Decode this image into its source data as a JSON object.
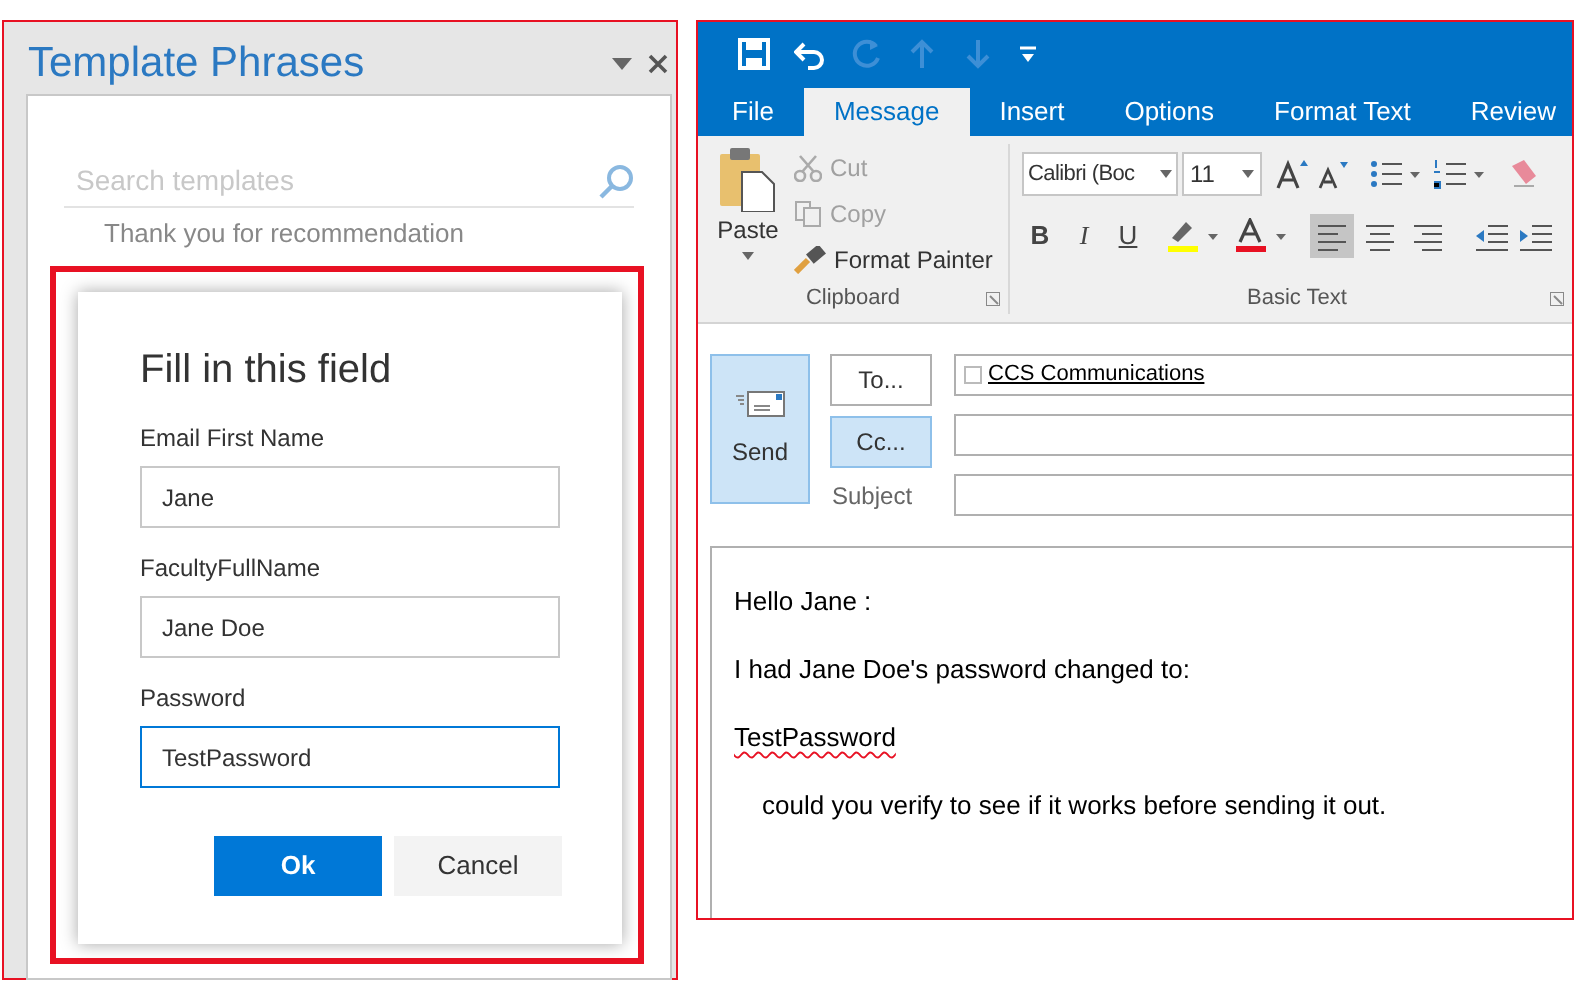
{
  "template_pane": {
    "title": "Template Phrases",
    "search": {
      "placeholder": "Search templates"
    },
    "items": [
      "Thank you for recommendation"
    ]
  },
  "dialog": {
    "title": "Fill in this field",
    "fields": [
      {
        "label": "Email First Name",
        "value": "Jane",
        "focused": false
      },
      {
        "label": "FacultyFullName",
        "value": "Jane Doe",
        "focused": false
      },
      {
        "label": "Password",
        "value": "TestPassword",
        "focused": true
      }
    ],
    "buttons": [
      {
        "label": "Ok",
        "kind": "primary"
      },
      {
        "label": "Cancel",
        "kind": "secondary"
      }
    ]
  },
  "outlook": {
    "quick_access": [
      {
        "kind": "save",
        "disabled": false
      },
      {
        "kind": "undo",
        "disabled": false
      },
      {
        "kind": "redo",
        "disabled": true
      },
      {
        "kind": "up",
        "disabled": true
      },
      {
        "kind": "down",
        "disabled": true
      },
      {
        "kind": "customize",
        "disabled": false
      }
    ],
    "tabs": [
      {
        "label": "File",
        "selected": false
      },
      {
        "label": "Message",
        "selected": true
      },
      {
        "label": "Insert",
        "selected": false
      },
      {
        "label": "Options",
        "selected": false
      },
      {
        "label": "Format Text",
        "selected": false
      },
      {
        "label": "Review",
        "selected": false
      }
    ],
    "clipboard": {
      "label": "Clipboard",
      "paste": "Paste",
      "commands": [
        {
          "kind": "cut",
          "label": "Cut",
          "disabled": true
        },
        {
          "kind": "copy",
          "label": "Copy",
          "disabled": true
        },
        {
          "kind": "format-painter",
          "label": "Format Painter",
          "disabled": false
        }
      ]
    },
    "basic_text": {
      "label": "Basic Text",
      "font": "Calibri (Boc",
      "size": "11",
      "styles": [
        "B",
        "I",
        "U"
      ],
      "alignments": [
        {
          "kind": "left",
          "selected": true
        },
        {
          "kind": "center",
          "selected": false
        },
        {
          "kind": "right",
          "selected": false
        }
      ]
    },
    "compose": {
      "send": "Send",
      "to_button": "To...",
      "cc_button": "Cc...",
      "cc_highlighted": true,
      "subject_label": "Subject",
      "to_recipients": [
        {
          "name": "CCS Communications",
          "checked": false
        }
      ],
      "body": [
        {
          "text": "Hello Jane :",
          "indented": false,
          "misspelled": false
        },
        {
          "text": "I had Jane Doe's password changed to:",
          "indented": false,
          "misspelled": false
        },
        {
          "text": "TestPassword",
          "indented": false,
          "misspelled": true
        },
        {
          "text": "could you verify to see if it works before sending it out.",
          "indented": true,
          "misspelled": false
        }
      ]
    }
  }
}
